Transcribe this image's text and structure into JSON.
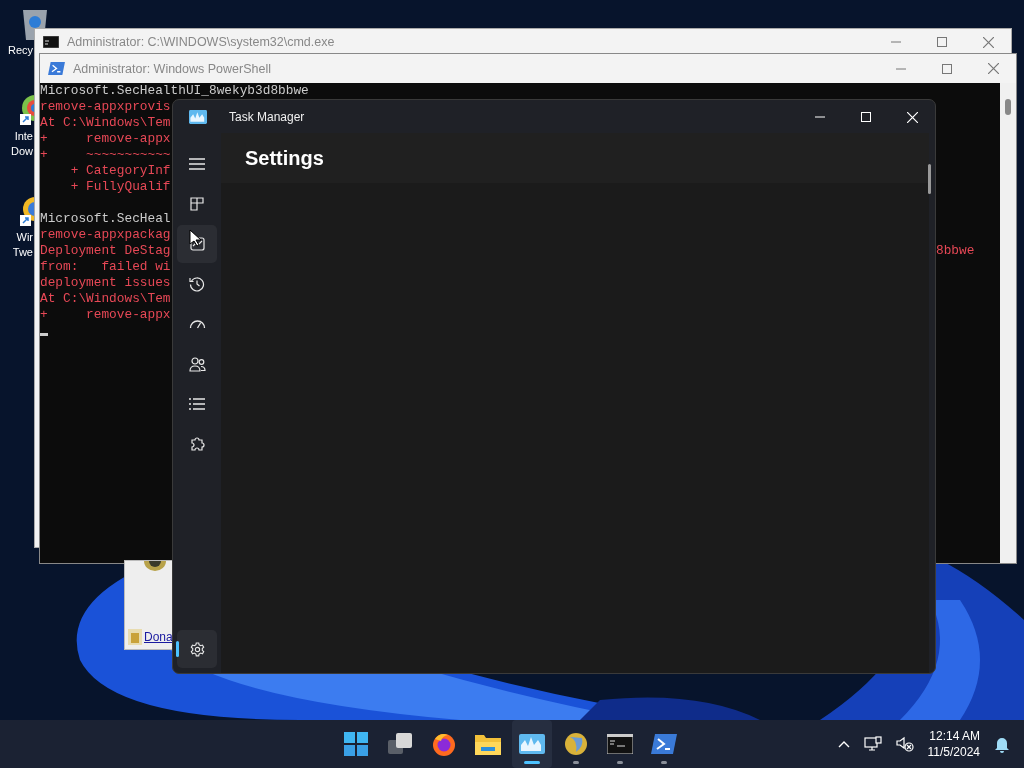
{
  "desktop_icons": [
    {
      "kind": "recycle-bin",
      "label_lines": [
        "Recy"
      ]
    },
    {
      "kind": "browser",
      "label_lines": [
        "Inte",
        "Dow"
      ]
    },
    {
      "kind": "tweaker",
      "label_lines": [
        "Wir",
        "Twe"
      ]
    }
  ],
  "cmd_window": {
    "title": "Administrator: C:\\WINDOWS\\system32\\cmd.exe"
  },
  "powershell_window": {
    "title": "Administrator: Windows PowerShell",
    "lines": [
      {
        "kind": "output",
        "text": "Microsoft.SecHealthUI_8wekyb3d8bbwe"
      },
      {
        "kind": "error",
        "text": "remove-appxprovis"
      },
      {
        "kind": "error",
        "text": "At C:\\Windows\\Tem"
      },
      {
        "kind": "error",
        "text": "+     remove-appx"
      },
      {
        "kind": "error",
        "text": "+     ~~~~~~~~~~~"
      },
      {
        "kind": "error",
        "text": "    + CategoryInf"
      },
      {
        "kind": "error",
        "text": "    + FullyQualif"
      },
      {
        "kind": "output"
      },
      {
        "kind": "output",
        "text": "Microsoft.SecHeal"
      },
      {
        "kind": "error",
        "text": "remove-appxpackag"
      },
      {
        "kind": "error",
        "text": "Deployment DeStag",
        "tail": "8bbwe"
      },
      {
        "kind": "error",
        "text": "from:   failed wi"
      },
      {
        "kind": "error",
        "text": "deployment issues"
      },
      {
        "kind": "error",
        "text": "At C:\\Windows\\Tem"
      },
      {
        "kind": "error",
        "text": "+     remove-appx"
      }
    ]
  },
  "browser_window": {
    "link": "Dona"
  },
  "task_manager": {
    "title": "Task Manager",
    "page_title": "Settings",
    "nav": [
      {
        "kind": "menu",
        "selected": false,
        "hovered": false
      },
      {
        "kind": "processes",
        "selected": false,
        "hovered": false
      },
      {
        "kind": "performance",
        "selected": false,
        "hovered": true
      },
      {
        "kind": "history",
        "selected": false,
        "hovered": false
      },
      {
        "kind": "startup",
        "selected": false,
        "hovered": false
      },
      {
        "kind": "users",
        "selected": false,
        "hovered": false
      },
      {
        "kind": "details",
        "selected": false,
        "hovered": false
      },
      {
        "kind": "services",
        "selected": false,
        "hovered": false
      },
      {
        "kind": "settings",
        "selected": true,
        "hovered": false
      }
    ]
  },
  "taskbar": {
    "apps": [
      {
        "kind": "start",
        "running": false,
        "active": false
      },
      {
        "kind": "taskview",
        "running": false,
        "active": false
      },
      {
        "kind": "firefox",
        "running": false,
        "active": false
      },
      {
        "kind": "explorer",
        "running": false,
        "active": false
      },
      {
        "kind": "taskmanager",
        "running": true,
        "active": true
      },
      {
        "kind": "globe",
        "running": true,
        "active": false
      },
      {
        "kind": "cmd",
        "running": true,
        "active": false
      },
      {
        "kind": "powershell",
        "running": true,
        "active": false
      }
    ],
    "time": "12:14 AM",
    "date": "11/5/2024"
  }
}
